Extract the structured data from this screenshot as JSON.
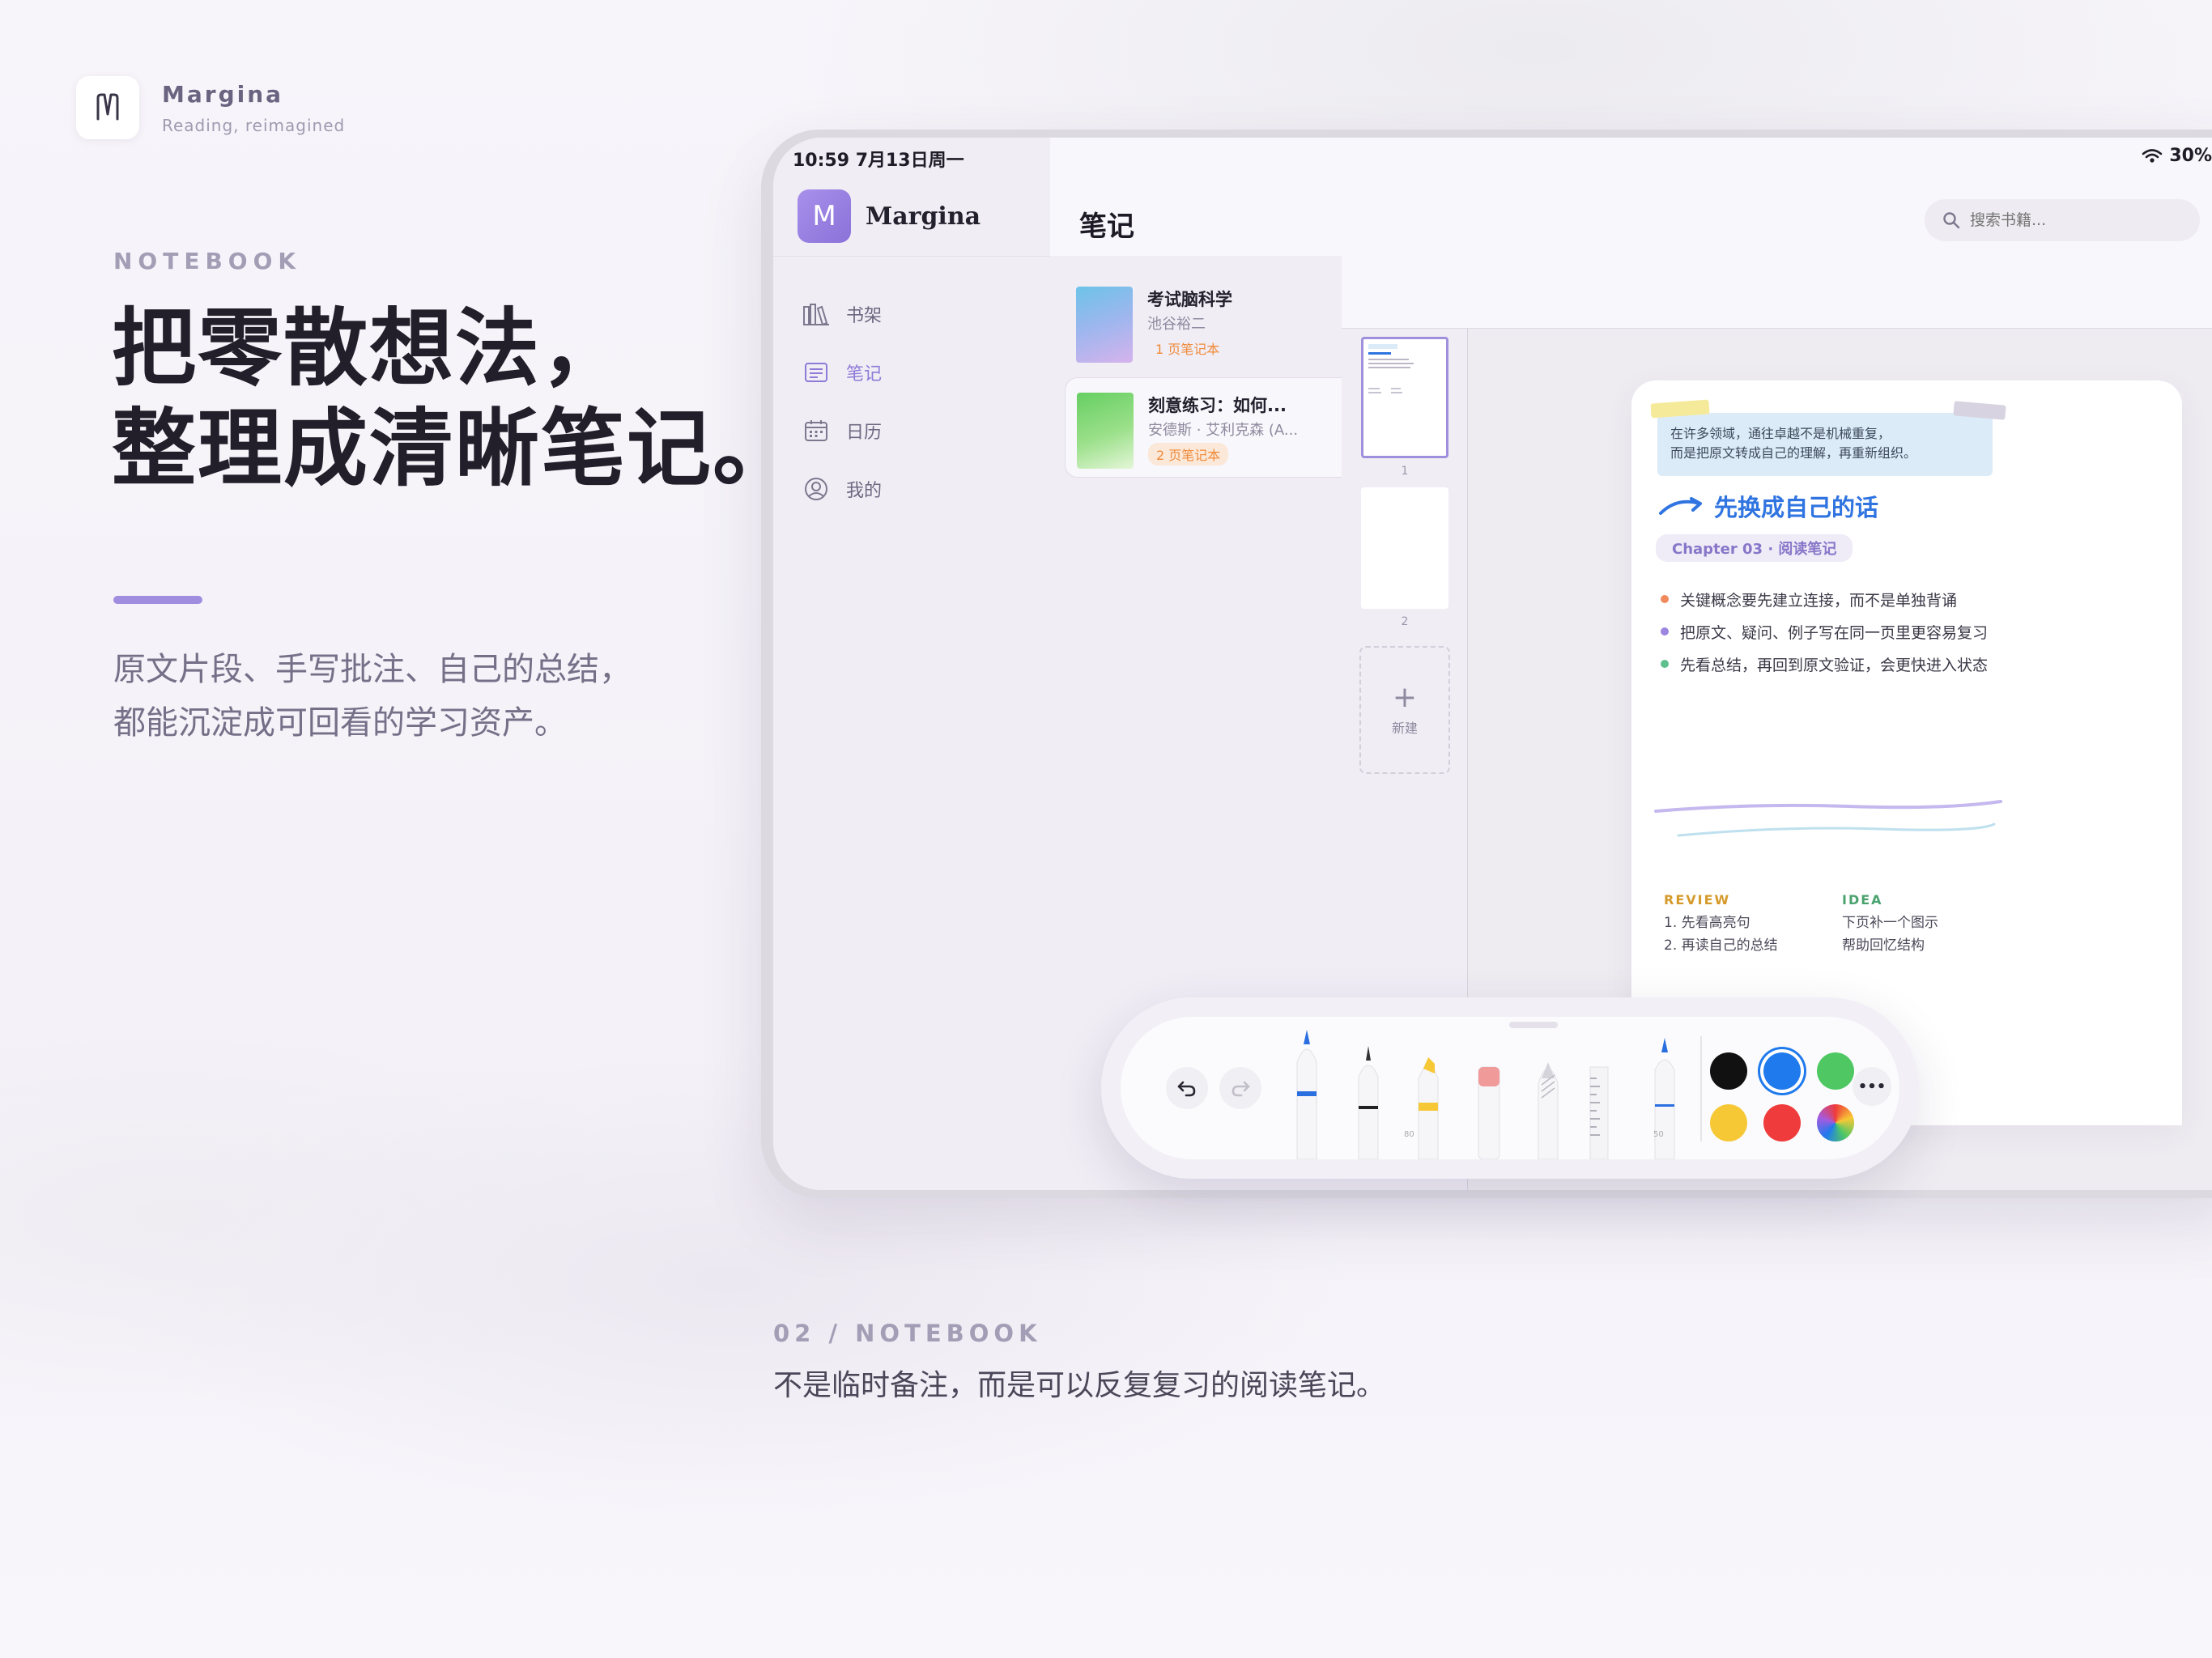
{
  "brand": {
    "name": "Margina",
    "tagline": "Reading, reimagined"
  },
  "hero": {
    "eyebrow": "NOTEBOOK",
    "headline_line1": "把零散想法，",
    "headline_line2": "整理成清晰笔记。",
    "subcopy_line1": "原文片段、手写批注、自己的总结，",
    "subcopy_line2": "都能沉淀成可回看的学习资产。"
  },
  "caption": {
    "kicker": "02 / NOTEBOOK",
    "text": "不是临时备注，而是可以反复复习的阅读笔记。"
  },
  "device": {
    "status": {
      "time": "10:59  7月13日周一",
      "battery": "30%"
    },
    "sidebar": {
      "app_initial": "M",
      "app_name": "Margina",
      "items": [
        {
          "label": "书架",
          "icon": "bookshelf-icon"
        },
        {
          "label": "笔记",
          "icon": "notebook-icon",
          "active": true
        },
        {
          "label": "日历",
          "icon": "calendar-icon"
        },
        {
          "label": "我的",
          "icon": "profile-icon"
        }
      ]
    },
    "main": {
      "title": "笔记",
      "search_placeholder": "搜索书籍..."
    },
    "books": [
      {
        "title": "考试脑科学",
        "author": "池谷裕二",
        "badge": "1 页笔记本"
      },
      {
        "title": "刻意练习：如何...",
        "author": "安德斯 · 艾利克森 (A...",
        "badge": "2 页笔记本",
        "selected": true
      }
    ],
    "thumbnails": [
      {
        "num": "1"
      },
      {
        "num": "2"
      }
    ],
    "new_page_label": "新建",
    "note": {
      "quote_line1": "在许多领域，通往卓越不是机械重复，",
      "quote_line2": "而是把原文转成自己的理解，再重新组织。",
      "heading": "先换成自己的话",
      "chapter": "Chapter 03 · 阅读笔记",
      "bullets": [
        {
          "text": "关键概念要先建立连接，而不是单独背诵",
          "color": "#f08a5d"
        },
        {
          "text": "把原文、疑问、例子写在同一页里更容易复习",
          "color": "#9b86e0"
        },
        {
          "text": "先看总结，再回到原文验证，会更快进入状态",
          "color": "#5fbf8e"
        }
      ],
      "review": {
        "label": "REVIEW",
        "line1": "1. 先看高亮句",
        "line2": "2. 再读自己的总结",
        "color": "#d59a2a"
      },
      "idea": {
        "label": "IDEA",
        "line1": "下页补一个图示",
        "line2": "帮助回忆结构",
        "color": "#4aa36f"
      }
    },
    "toolbar": {
      "undo_icon": "undo-icon",
      "redo_icon": "redo-icon",
      "more_label": "•••",
      "pen_sizes": {
        "marker": "80",
        "fountain": "50"
      },
      "colors": [
        "#111111",
        "#1f7aed",
        "#4fc864",
        "#f7c836",
        "#ef3b3b"
      ]
    }
  }
}
